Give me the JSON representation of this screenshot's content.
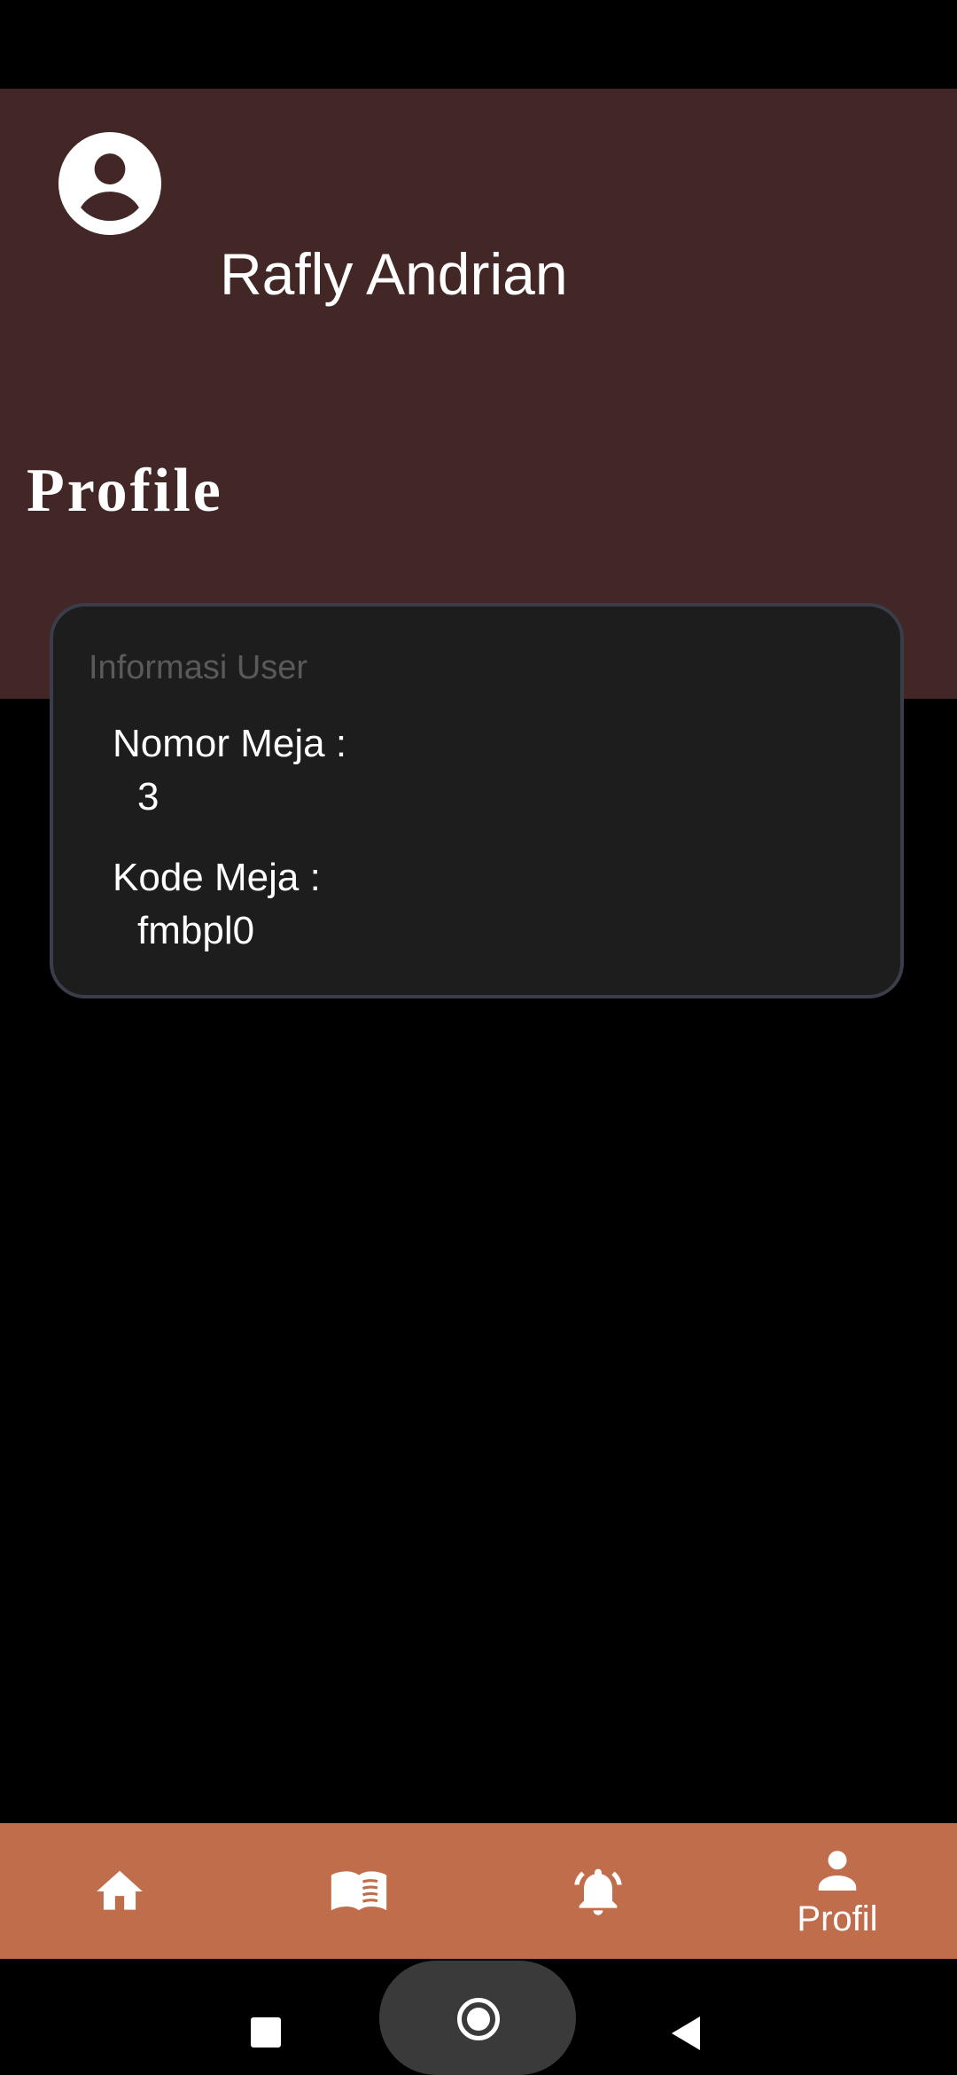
{
  "header": {
    "user_name": "Rafly Andrian",
    "page_title": "Profile",
    "background_color": "#432626",
    "avatar_icon": "account-circle-icon"
  },
  "info_card": {
    "title": "Informasi User",
    "fields": [
      {
        "label": "Nomor Meja :",
        "value": "3"
      },
      {
        "label": "Kode Meja :",
        "value": "fmbpl0"
      }
    ]
  },
  "bottom_nav": {
    "background_color": "#c06d4b",
    "items": [
      {
        "icon": "home-icon",
        "label": ""
      },
      {
        "icon": "menu-book-icon",
        "label": ""
      },
      {
        "icon": "notification-bell-icon",
        "label": ""
      },
      {
        "icon": "person-icon",
        "label": "Profil",
        "active": true
      }
    ]
  },
  "system_nav": {
    "buttons": [
      "recents-icon",
      "home-icon",
      "back-icon"
    ]
  }
}
